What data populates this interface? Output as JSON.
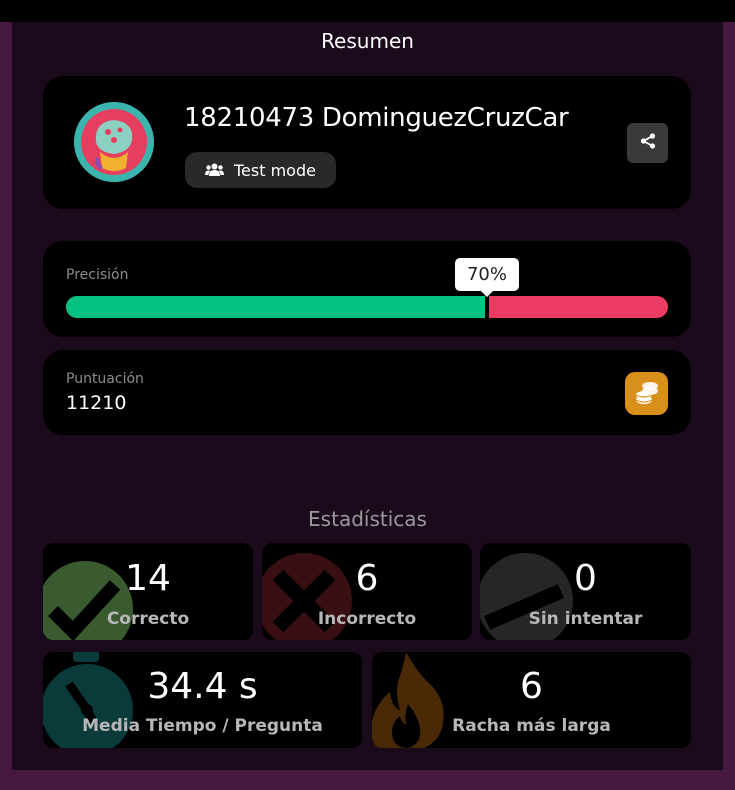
{
  "header": {
    "title": "Resumen"
  },
  "user": {
    "name": "18210473 DominguezCruzCar",
    "mode_label": "Test mode"
  },
  "accuracy": {
    "label": "Precisión",
    "percent_text": "70%",
    "value": 0.7
  },
  "score": {
    "label": "Puntuación",
    "value": "11210"
  },
  "stats": {
    "title": "Estadísticas",
    "correct": {
      "value": "14",
      "label": "Correcto",
      "icon": "check-icon"
    },
    "incorrect": {
      "value": "6",
      "label": "Incorrecto",
      "icon": "cross-icon"
    },
    "unattempted": {
      "value": "0",
      "label": "Sin intentar",
      "icon": "minus-icon"
    },
    "avg_time": {
      "value": "34.4 s",
      "label": "Media Tiempo / Pregunta",
      "icon": "stopwatch-icon"
    },
    "streak": {
      "value": "6",
      "label": "Racha más larga",
      "icon": "flame-icon"
    }
  },
  "colors": {
    "background": "#46173f",
    "panel": "#1b0a1b",
    "correct": "#05c282",
    "incorrect": "#ec3b62",
    "coin": "#d9901b"
  }
}
